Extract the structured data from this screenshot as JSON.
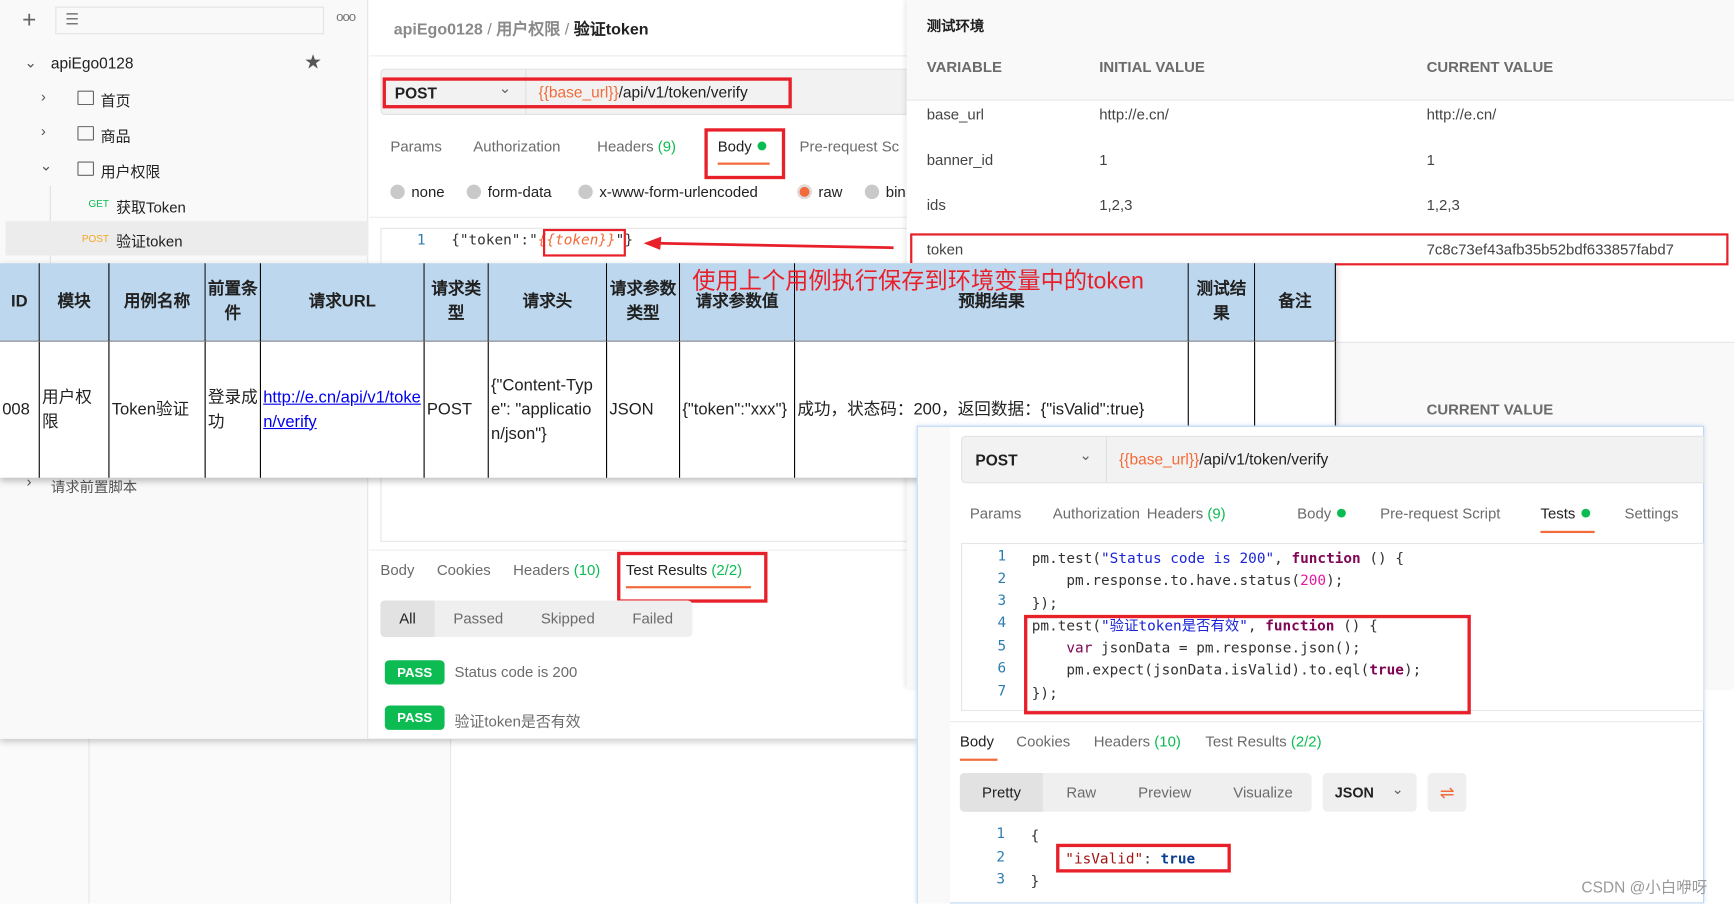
{
  "sidebar": {
    "new_icon": "plus-icon",
    "filter_icon": "filter-icon",
    "more_icon": "more-icon",
    "collection": "apiEgo0128",
    "items": [
      {
        "label": "首页",
        "type": "folder"
      },
      {
        "label": "商品",
        "type": "folder"
      },
      {
        "label": "用户权限",
        "type": "folder"
      },
      {
        "method": "GET",
        "label": "获取Token"
      },
      {
        "method": "POST",
        "label": "验证token"
      }
    ],
    "pre_script": "请求前置脚本"
  },
  "breadcrumb": [
    "apiEgo0128",
    "用户权限",
    "验证token"
  ],
  "request": {
    "method": "POST",
    "url_var": "{{base_url}}",
    "url_path": "/api/v1/token/verify",
    "tabs": [
      "Params",
      "Authorization",
      "Headers",
      "(9)",
      "Body",
      "Pre-request Sc"
    ],
    "body_modes": [
      "none",
      "form-data",
      "x-www-form-urlencoded",
      "raw",
      "bin"
    ],
    "body_line_no": "1",
    "body_pre": "{\"token\":\"",
    "body_var": "{{token}}",
    "body_post": "\"}"
  },
  "response": {
    "tabs": [
      "Body",
      "Cookies",
      "Headers",
      "(10)",
      "Test Results",
      "(2/2)"
    ],
    "filters": [
      "All",
      "Passed",
      "Skipped",
      "Failed"
    ],
    "results": [
      {
        "status": "PASS",
        "name": "Status code is 200"
      },
      {
        "status": "PASS",
        "name": "验证token是否有效"
      }
    ]
  },
  "environment": {
    "title": "测试环境",
    "columns": [
      "VARIABLE",
      "INITIAL VALUE",
      "CURRENT VALUE"
    ],
    "rows": [
      [
        "base_url",
        "http://e.cn/",
        "http://e.cn/"
      ],
      [
        "banner_id",
        "1",
        "1"
      ],
      [
        "ids",
        "1,2,3",
        "1,2,3"
      ],
      [
        "token",
        "",
        "7c8c73ef43afb35b52bdf633857fabd7"
      ]
    ],
    "lower_column": "CURRENT VALUE"
  },
  "testcase_table": {
    "headers": [
      "ID",
      "模块",
      "用例名称",
      "前置条件",
      "请求URL",
      "请求类型",
      "请求头",
      "请求参数类型",
      "请求参数值",
      "预期结果",
      "测试结果",
      "备注"
    ],
    "row": [
      "008",
      "用户权限",
      "Token验证",
      "登录成功",
      "http://e.cn/api/v1/token/verify",
      "POST",
      "{\"Content-Type\": \"application/json\"}",
      "JSON",
      "{\"token\":\"xxx\"}",
      "成功，状态码：200，返回数据：{\"isValid\":true}",
      "",
      ""
    ],
    "header_color": "#bdd7ee"
  },
  "annotation": "使用上个用例执行保存到环境变量中的token",
  "tests_panel": {
    "method": "POST",
    "url_var": "{{base_url}}",
    "url_path": "/api/v1/token/verify",
    "tabs": [
      "Params",
      "Authorization",
      "Headers",
      "(9)",
      "Body",
      "Pre-request Script",
      "Tests",
      "Settings"
    ],
    "code": [
      "1",
      "2",
      "3",
      "4",
      "5",
      "6",
      "7"
    ],
    "response_tabs": [
      "Body",
      "Cookies",
      "Headers",
      "(10)",
      "Test Results",
      "(2/2)"
    ],
    "views": [
      "Pretty",
      "Raw",
      "Preview",
      "Visualize"
    ],
    "format": "JSON",
    "wrap_icon": "wrap-lines-icon",
    "resp_lines": [
      "1",
      "2",
      "3"
    ],
    "resp_key": "\"isValid\"",
    "resp_value": "true"
  },
  "watermark": "CSDN @小白咿呀",
  "colors": {
    "accent": "#f26b3a",
    "success": "#0cbb52",
    "highlight": "#e8202a"
  }
}
